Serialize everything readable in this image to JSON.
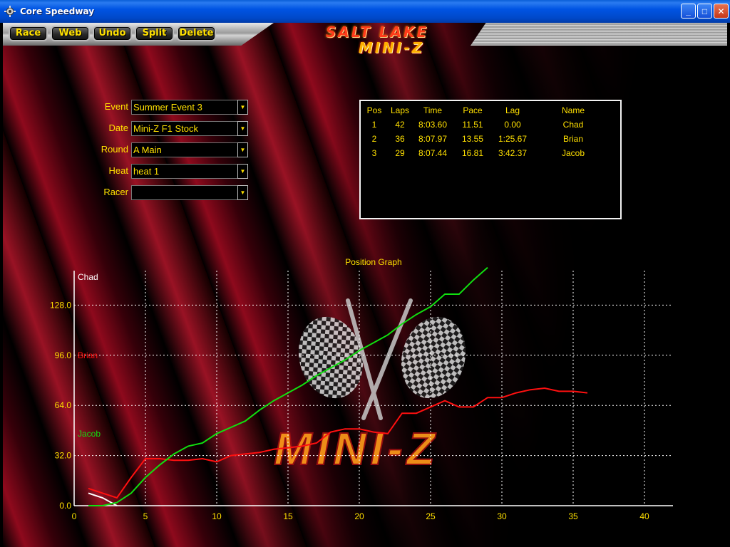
{
  "window": {
    "title": "Core Speedway",
    "minimize_label": "_",
    "maximize_label": "□",
    "close_label": "✕"
  },
  "toolbar": {
    "buttons": [
      "Race",
      "Web",
      "Undo",
      "Split",
      "Delete"
    ]
  },
  "logo": {
    "line1": "SALT LAKE",
    "line2": "MINI-Z",
    "watermark": "MINI-Z"
  },
  "form": {
    "fields": [
      {
        "label": "Event",
        "value": "Summer Event 3"
      },
      {
        "label": "Date",
        "value": "Mini-Z F1 Stock"
      },
      {
        "label": "Round",
        "value": "A Main"
      },
      {
        "label": "Heat",
        "value": "heat 1"
      },
      {
        "label": "Racer",
        "value": ""
      }
    ]
  },
  "results": {
    "headers": [
      "Pos",
      "Laps",
      "Time",
      "Pace",
      "Lag",
      "Name"
    ],
    "rows": [
      [
        "1",
        "42",
        "8:03.60",
        "11.51",
        "0.00",
        "Chad"
      ],
      [
        "2",
        "36",
        "8:07.97",
        "13.55",
        "1:25.67",
        "Brian"
      ],
      [
        "3",
        "29",
        "8:07.44",
        "16.81",
        "3:42.37",
        "Jacob"
      ]
    ]
  },
  "colors": {
    "accent_yellow": "#ffe000",
    "chad": "#ffffff",
    "brian": "#ff1010",
    "jacob": "#10e010",
    "grid": "#ffffff"
  },
  "chart_data": {
    "type": "line",
    "title": "Position Graph",
    "xlim": [
      0,
      42
    ],
    "ylim": [
      0,
      150
    ],
    "x_ticks": [
      0,
      5,
      10,
      15,
      20,
      25,
      30,
      35,
      40
    ],
    "y_ticks": [
      "0.0",
      "32.0",
      "64.0",
      "96.0",
      "128.0"
    ],
    "y_tick_values": [
      0,
      32,
      64,
      96,
      128
    ],
    "legend": [
      "Chad",
      "Brian",
      "Jacob"
    ],
    "legend_placement": "left, stacked vertically",
    "grid": true,
    "series": [
      {
        "name": "Chad",
        "color": "#ffffff",
        "x": [
          1,
          2,
          3
        ],
        "y": [
          8,
          5,
          0
        ]
      },
      {
        "name": "Brian",
        "color": "#ff1010",
        "x": [
          1,
          2,
          3,
          4,
          5,
          6,
          7,
          8,
          9,
          10,
          11,
          12,
          13,
          14,
          15,
          16,
          17,
          18,
          19,
          20,
          21,
          22,
          23,
          24,
          25,
          26,
          27,
          28,
          29,
          30,
          31,
          32,
          33,
          34,
          35,
          36
        ],
        "y": [
          11,
          8,
          5,
          18,
          30,
          30,
          29,
          29,
          30,
          28,
          32,
          33,
          34,
          36,
          37,
          38,
          40,
          47,
          49,
          49,
          47,
          46,
          59,
          59,
          63,
          67,
          63,
          63,
          69,
          69,
          72,
          74,
          75,
          73,
          73,
          72
        ]
      },
      {
        "name": "Jacob",
        "color": "#10e010",
        "x": [
          1,
          2,
          3,
          4,
          5,
          6,
          7,
          8,
          9,
          10,
          11,
          12,
          13,
          14,
          15,
          16,
          17,
          18,
          19,
          20,
          21,
          22,
          23,
          24,
          25,
          26,
          27,
          28,
          29
        ],
        "y": [
          0,
          0,
          2,
          8,
          18,
          26,
          33,
          38,
          40,
          46,
          50,
          54,
          61,
          67,
          72,
          77,
          83,
          88,
          93,
          99,
          104,
          109,
          116,
          122,
          127,
          135,
          135,
          144,
          152
        ]
      }
    ]
  }
}
